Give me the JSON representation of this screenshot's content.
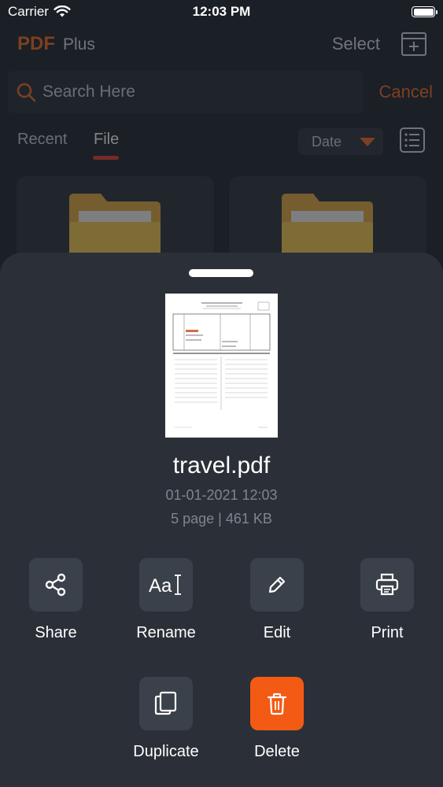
{
  "status_bar": {
    "carrier": "Carrier",
    "time": "12:03 PM"
  },
  "header": {
    "logo_pdf": "PDF",
    "logo_plus": "Plus",
    "select_label": "Select"
  },
  "search": {
    "placeholder": "Search Here",
    "value": "",
    "cancel_label": "Cancel"
  },
  "tabs": [
    {
      "label": "Recent"
    },
    {
      "label": "File",
      "active": true
    }
  ],
  "sort": {
    "selected": "Date"
  },
  "sheet": {
    "file_name": "travel.pdf",
    "date": "01-01-2021 12:03",
    "info": "5 page | 461 KB",
    "actions": [
      {
        "label": "Share",
        "icon": "share-icon"
      },
      {
        "label": "Rename",
        "icon": "rename-icon"
      },
      {
        "label": "Edit",
        "icon": "pencil-icon"
      },
      {
        "label": "Print",
        "icon": "printer-icon"
      },
      {
        "label": "Duplicate",
        "icon": "duplicate-icon"
      },
      {
        "label": "Delete",
        "icon": "trash-icon"
      }
    ]
  },
  "colors": {
    "accent": "#f26a1b",
    "danger": "#f35a14",
    "tab_indicator": "#e23a2a",
    "background": "#1b1f26",
    "sheet": "#2b3038"
  }
}
